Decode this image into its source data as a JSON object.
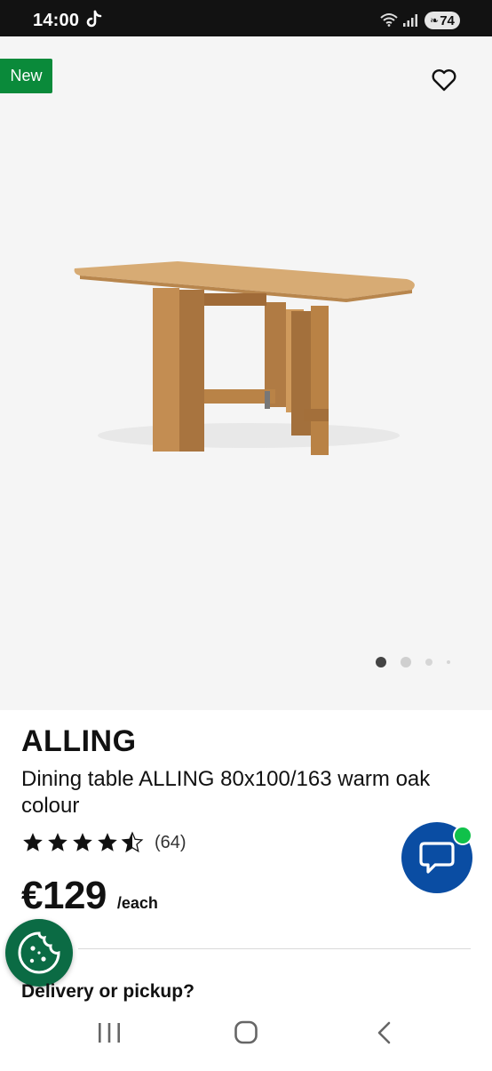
{
  "status_bar": {
    "time": "14:00",
    "battery": "74",
    "icons": [
      "tiktok-icon",
      "wifi-icon",
      "signal-icon",
      "battery-icon"
    ]
  },
  "gallery": {
    "badge": "New",
    "favorite_icon": "heart-outline-icon",
    "image_alt": "Dining table ALLING",
    "pagination": {
      "total": 4,
      "active": 1
    }
  },
  "product": {
    "name": "ALLING",
    "description": "Dining table ALLING 80x100/163 warm oak colour",
    "rating": {
      "value": 4.5,
      "max": 5,
      "count": "(64)"
    },
    "price": "€129",
    "unit": "/each"
  },
  "floating": {
    "chat_icon": "chat-bubble-icon",
    "cookie_icon": "cookie-icon"
  },
  "delivery": {
    "title": "Delivery or pickup?"
  },
  "navigation": {
    "buttons": [
      "recent-apps-icon",
      "home-icon",
      "back-icon"
    ]
  },
  "colors": {
    "badge_green": "#0a8a3a",
    "chat_blue": "#0a4da3",
    "online_green": "#10c14a",
    "cookie_green": "#0b6b44",
    "status_bar": "#121212"
  }
}
